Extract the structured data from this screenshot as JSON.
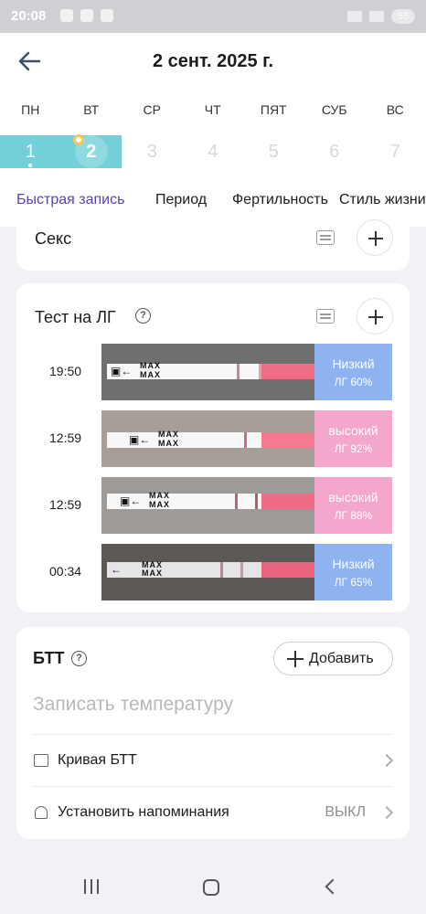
{
  "status_bar": {
    "time": "20:08",
    "battery": "55"
  },
  "header": {
    "title": "2 сент. 2025 г."
  },
  "week": {
    "days_of_week": [
      "ПН",
      "ВТ",
      "СР",
      "ЧТ",
      "ПЯТ",
      "СУБ",
      "ВС"
    ],
    "dates": [
      "1",
      "2",
      "3",
      "4",
      "5",
      "6",
      "7"
    ]
  },
  "tabs": [
    "Быстрая запись",
    "Период",
    "Фертильность",
    "Стиль жизни"
  ],
  "sex_card": {
    "title": "Секс"
  },
  "lh_card": {
    "title": "Тест на ЛГ",
    "help": "?",
    "strip_label_top": "MAX",
    "strip_label_bottom": "MAX",
    "tests": [
      {
        "time": "19:50",
        "level": "Низкий",
        "percent": "ЛГ 60%",
        "color": "#8fb3f1"
      },
      {
        "time": "12:59",
        "level": "высокий",
        "percent": "ЛГ 92%",
        "color": "#f4a7cc"
      },
      {
        "time": "12:59",
        "level": "высокий",
        "percent": "ЛГ 88%",
        "color": "#f4a7cc"
      },
      {
        "time": "00:34",
        "level": "Низкий",
        "percent": "ЛГ 65%",
        "color": "#8fb3f1"
      }
    ]
  },
  "btt_card": {
    "title": "БТТ",
    "help": "?",
    "add_label": "Добавить",
    "temp_placeholder": "Записать температуру",
    "curve_label": "Кривая БТТ",
    "reminder_label": "Установить напоминания",
    "reminder_value": "ВЫКЛ"
  },
  "colors": {
    "accent": "#5b3fb5",
    "week_highlight": "#73cfd8",
    "low": "#8fb3f1",
    "high": "#f4a7cc"
  }
}
